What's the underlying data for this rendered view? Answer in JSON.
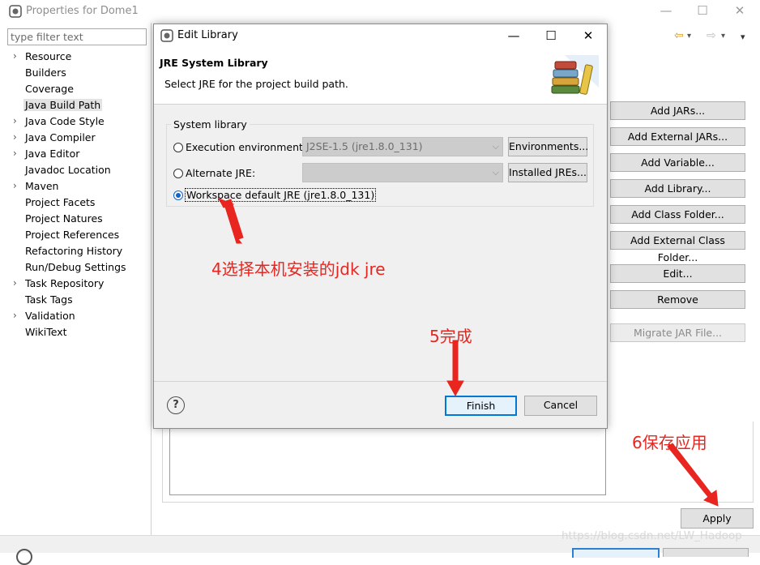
{
  "outer_window": {
    "title": "Properties for Dome1",
    "controls": {
      "minimize": "—",
      "maximize": "☐",
      "close": "✕"
    },
    "filter_placeholder": "type filter text",
    "nav": {
      "back": "⇦",
      "forward": "⇨",
      "menu": "▾"
    },
    "nav_items": [
      {
        "label": "Resource",
        "expandable": true
      },
      {
        "label": "Builders",
        "expandable": false
      },
      {
        "label": "Coverage",
        "expandable": false
      },
      {
        "label": "Java Build Path",
        "expandable": false,
        "selected": true
      },
      {
        "label": "Java Code Style",
        "expandable": true
      },
      {
        "label": "Java Compiler",
        "expandable": true
      },
      {
        "label": "Java Editor",
        "expandable": true
      },
      {
        "label": "Javadoc Location",
        "expandable": false
      },
      {
        "label": "Maven",
        "expandable": true
      },
      {
        "label": "Project Facets",
        "expandable": false
      },
      {
        "label": "Project Natures",
        "expandable": false
      },
      {
        "label": "Project References",
        "expandable": false
      },
      {
        "label": "Refactoring History",
        "expandable": false
      },
      {
        "label": "Run/Debug Settings",
        "expandable": false
      },
      {
        "label": "Task Repository",
        "expandable": true
      },
      {
        "label": "Task Tags",
        "expandable": false
      },
      {
        "label": "Validation",
        "expandable": true
      },
      {
        "label": "WikiText",
        "expandable": false
      }
    ],
    "right_buttons": [
      {
        "label": "Add JARs...",
        "enabled": true
      },
      {
        "label": "Add External JARs...",
        "enabled": true
      },
      {
        "label": "Add Variable...",
        "enabled": true
      },
      {
        "label": "Add Library...",
        "enabled": true
      },
      {
        "label": "Add Class Folder...",
        "enabled": true
      },
      {
        "label": "Add External Class Folder...",
        "enabled": true
      },
      {
        "label": "Edit...",
        "enabled": true
      },
      {
        "label": "Remove",
        "enabled": true
      },
      {
        "label": "Migrate JAR File...",
        "enabled": false
      }
    ],
    "apply_label": "Apply"
  },
  "dialog": {
    "title": "Edit Library",
    "controls": {
      "minimize": "—",
      "maximize": "☐",
      "close": "✕"
    },
    "heading": "JRE System Library",
    "description": "Select JRE for the project build path.",
    "group_label": "System library",
    "options": [
      {
        "label": "Execution environment:",
        "selected": false,
        "combo_value": "J2SE-1.5 (jre1.8.0_131)",
        "button": "Environments..."
      },
      {
        "label": "Alternate JRE:",
        "selected": false,
        "combo_value": "",
        "button": "Installed JREs..."
      },
      {
        "label": "Workspace default JRE (jre1.8.0_131)",
        "selected": true
      }
    ],
    "help_symbol": "?",
    "finish_label": "Finish",
    "cancel_label": "Cancel"
  },
  "annotations": {
    "step4": "4选择本机安装的jdk jre",
    "step5": "5完成",
    "step6": "6保存应用",
    "color": "#e8251f"
  },
  "watermark": "https://blog.csdn.net/LW_Hadoop"
}
